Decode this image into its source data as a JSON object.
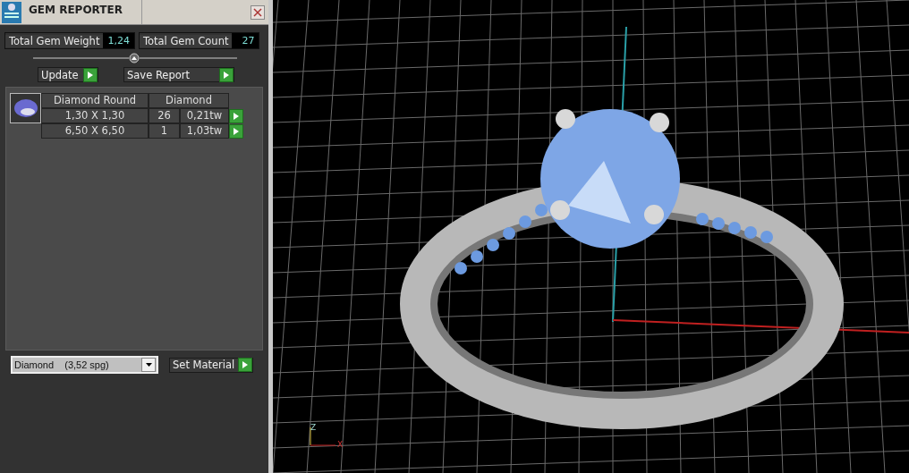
{
  "window": {
    "title": "GEM REPORTER"
  },
  "totals": [
    {
      "label": "Total Gem Weight",
      "value": "1,24"
    },
    {
      "label": "Total Gem Count",
      "value": "27"
    }
  ],
  "actions": [
    {
      "label": "Update"
    },
    {
      "label": "Save Report"
    }
  ],
  "gem_table": {
    "columns": [
      "Diamond Round",
      "Diamond"
    ],
    "rows": [
      {
        "size": "1,30 X 1,30",
        "count": "26",
        "weight": "0,21tw"
      },
      {
        "size": "6,50 X 6,50",
        "count": "1",
        "weight": "1,03tw"
      }
    ]
  },
  "material": {
    "value": "Diamond    (3,52 spg)",
    "button": "Set Material"
  },
  "viewport": {
    "axis_labels": [
      "Z",
      "X"
    ]
  }
}
